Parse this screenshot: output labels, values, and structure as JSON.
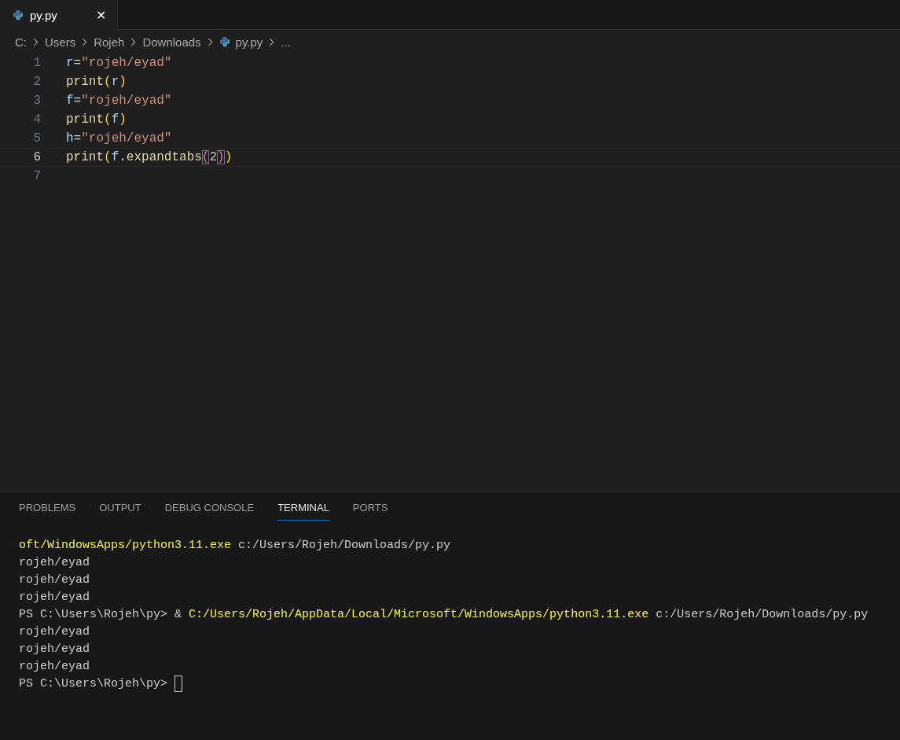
{
  "tabs": [
    {
      "label": "py.py",
      "selected": true,
      "close": "✕"
    }
  ],
  "breadcrumb": [
    {
      "label": "C:",
      "kind": "folder"
    },
    {
      "label": "Users",
      "kind": "folder"
    },
    {
      "label": "Rojeh",
      "kind": "folder"
    },
    {
      "label": "Downloads",
      "kind": "folder"
    },
    {
      "label": "py.py",
      "kind": "file"
    },
    {
      "label": "...",
      "kind": "folder"
    }
  ],
  "editor": {
    "lines": [
      {
        "number": "1",
        "current": false,
        "tokens": [
          {
            "text": "r",
            "kind": "var"
          },
          {
            "text": "=",
            "kind": "op"
          },
          {
            "text": "\"rojeh/eyad\"",
            "kind": "str"
          }
        ]
      },
      {
        "number": "2",
        "current": false,
        "tokens": [
          {
            "text": "print",
            "kind": "func"
          },
          {
            "text": "(",
            "kind": "paren"
          },
          {
            "text": "r",
            "kind": "var"
          },
          {
            "text": ")",
            "kind": "paren"
          }
        ]
      },
      {
        "number": "3",
        "current": false,
        "tokens": [
          {
            "text": "f",
            "kind": "var"
          },
          {
            "text": "=",
            "kind": "op"
          },
          {
            "text": "\"rojeh/eyad\"",
            "kind": "str"
          }
        ]
      },
      {
        "number": "4",
        "current": false,
        "tokens": [
          {
            "text": "print",
            "kind": "func"
          },
          {
            "text": "(",
            "kind": "paren"
          },
          {
            "text": "f",
            "kind": "var"
          },
          {
            "text": ")",
            "kind": "paren"
          }
        ]
      },
      {
        "number": "5",
        "current": false,
        "tokens": [
          {
            "text": "h",
            "kind": "var"
          },
          {
            "text": "=",
            "kind": "op"
          },
          {
            "text": "\"rojeh/eyad\"",
            "kind": "str"
          }
        ]
      },
      {
        "number": "6",
        "current": true,
        "tokens": [
          {
            "text": "print",
            "kind": "func"
          },
          {
            "text": "(",
            "kind": "paren"
          },
          {
            "text": "f",
            "kind": "var"
          },
          {
            "text": ".expandtabs",
            "kind": "func"
          },
          {
            "text": "(",
            "kind": "paren2",
            "matched": true
          },
          {
            "text": "2",
            "kind": "num"
          },
          {
            "text": ")",
            "kind": "paren2",
            "matched": true
          },
          {
            "text": ")",
            "kind": "paren"
          }
        ]
      },
      {
        "number": "7",
        "current": false
      }
    ]
  },
  "panel": {
    "tabs": [
      {
        "label": "PROBLEMS",
        "selected": false
      },
      {
        "label": "OUTPUT",
        "selected": false
      },
      {
        "label": "DEBUG CONSOLE",
        "selected": false
      },
      {
        "label": "TERMINAL",
        "selected": true
      },
      {
        "label": "PORTS",
        "selected": false
      }
    ],
    "terminal": [
      {
        "cursor": false,
        "segments": [
          {
            "text": "oft/WindowsApps/python3.11.exe",
            "kind": "cmd"
          },
          {
            "text": " c:/Users/Rojeh/Downloads/py.py",
            "kind": "text"
          }
        ]
      },
      {
        "cursor": false,
        "segments": [
          {
            "text": "rojeh/eyad",
            "kind": "text"
          }
        ]
      },
      {
        "cursor": false,
        "segments": [
          {
            "text": "rojeh/eyad",
            "kind": "text"
          }
        ]
      },
      {
        "cursor": false,
        "segments": [
          {
            "text": "rojeh/eyad",
            "kind": "text"
          }
        ]
      },
      {
        "cursor": false,
        "segments": [
          {
            "text": "PS C:\\Users\\Rojeh\\py> & ",
            "kind": "text"
          },
          {
            "text": "C:/Users/Rojeh/AppData/Local/Microsoft/WindowsApps/python3.11.exe",
            "kind": "cmd"
          },
          {
            "text": " c:/Users/Rojeh/Downloads/py.py",
            "kind": "text"
          }
        ]
      },
      {
        "cursor": false,
        "segments": [
          {
            "text": "rojeh/eyad",
            "kind": "text"
          }
        ]
      },
      {
        "cursor": false,
        "segments": [
          {
            "text": "rojeh/eyad",
            "kind": "text"
          }
        ]
      },
      {
        "cursor": false,
        "segments": [
          {
            "text": "rojeh/eyad",
            "kind": "text"
          }
        ]
      },
      {
        "cursor": true,
        "segments": [
          {
            "text": "PS C:\\Users\\Rojeh\\py> ",
            "kind": "text"
          }
        ]
      }
    ]
  }
}
